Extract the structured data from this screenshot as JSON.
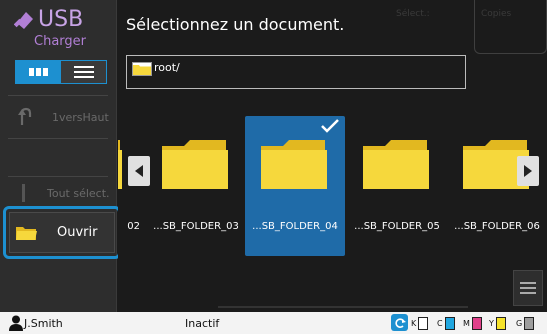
{
  "app": {
    "title": "USB",
    "subtitle": "Charger",
    "title_icon": "usb-icon"
  },
  "sidebar": {
    "view_modes": [
      {
        "name": "thumbnail-view",
        "icon": "thumbnail-grid-icon",
        "active": true
      },
      {
        "name": "list-view",
        "icon": "list-icon",
        "active": false
      }
    ],
    "up_label": "1versHaut",
    "select_all_label": "Tout sélect.",
    "open_label": "Ouvrir"
  },
  "main": {
    "title": "Sélectionnez un document.",
    "select_count_label": "Sélect.:",
    "copies_label": "Copies",
    "path": "root/",
    "folders": [
      {
        "name": "02",
        "selected": false
      },
      {
        "name": "...SB_FOLDER_03",
        "selected": false
      },
      {
        "name": "...SB_FOLDER_04",
        "selected": true
      },
      {
        "name": "...SB_FOLDER_05",
        "selected": false
      },
      {
        "name": "...SB_FOLDER_06",
        "selected": false
      }
    ]
  },
  "status": {
    "user": "J.Smith",
    "state": "Inactif",
    "toners": [
      {
        "letter": "K",
        "color": "#ffffff"
      },
      {
        "letter": "C",
        "color": "#21a7e0"
      },
      {
        "letter": "M",
        "color": "#e0408a"
      },
      {
        "letter": "Y",
        "color": "#f5e22a"
      },
      {
        "letter": "G",
        "color": "#9e9e9e"
      }
    ]
  },
  "colors": {
    "accent": "#1d90d0",
    "selected_tile": "#1f6ba8",
    "brand": "#c8a4e6",
    "folder_yellow": "#f6d83c"
  }
}
